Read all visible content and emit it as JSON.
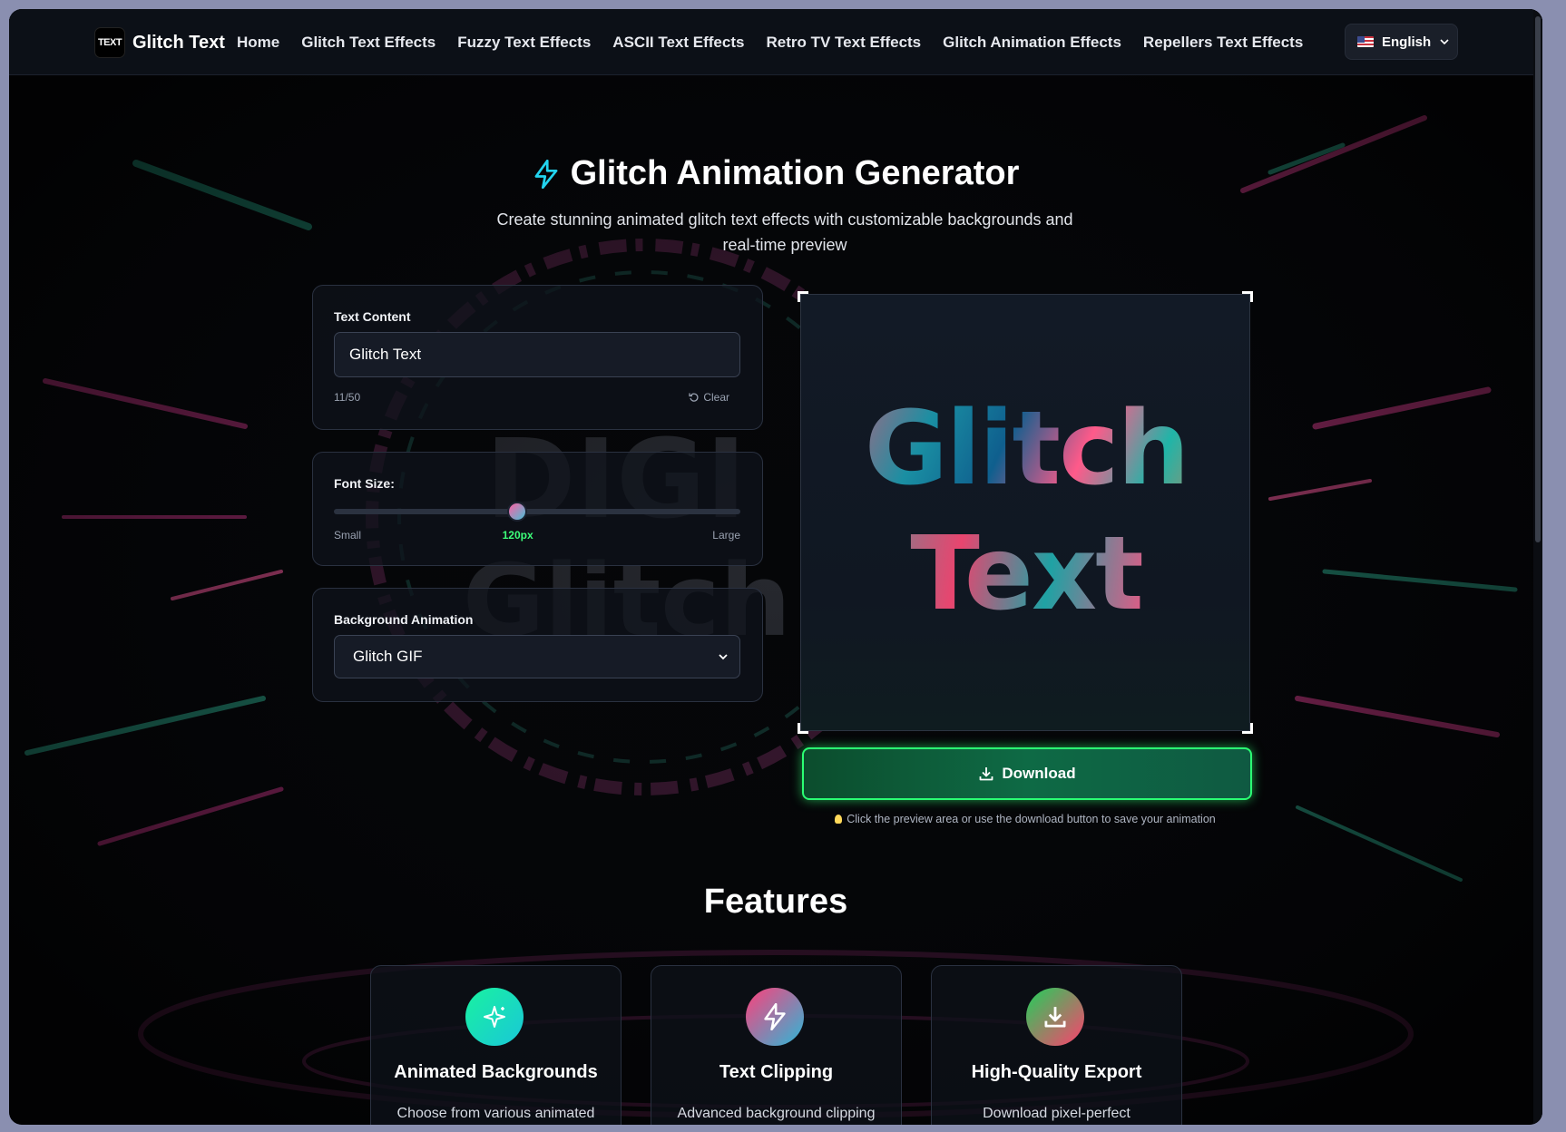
{
  "brand": {
    "logo_text": "TEXT",
    "name": "Glitch Text"
  },
  "nav": {
    "links": [
      "Home",
      "Glitch Text Effects",
      "Fuzzy Text Effects",
      "ASCII Text Effects",
      "Retro TV Text Effects",
      "Glitch Animation Effects",
      "Repellers Text Effects"
    ],
    "language": "English"
  },
  "hero": {
    "title": "Glitch Animation Generator",
    "subtitle": "Create stunning animated glitch text effects with customizable backgrounds and real-time preview"
  },
  "text_panel": {
    "label": "Text Content",
    "value": "Glitch Text",
    "counter": "11/50",
    "clear_label": "Clear"
  },
  "font_panel": {
    "label": "Font Size:",
    "min_label": "Small",
    "max_label": "Large",
    "value_label": "120px",
    "fraction": 0.45
  },
  "bg_panel": {
    "label": "Background Animation",
    "selected": "Glitch GIF"
  },
  "preview": {
    "line1": "Glitch",
    "line2": "Text"
  },
  "download": {
    "label": "Download",
    "hint": "Click the preview area or use the download button to save your animation"
  },
  "features": {
    "title": "Features",
    "cards": [
      {
        "title": "Animated Backgrounds",
        "desc": "Choose from various animated GIF and WebP"
      },
      {
        "title": "Text Clipping",
        "desc": "Advanced background clipping creates stunning"
      },
      {
        "title": "High-Quality Export",
        "desc": "Download pixel-perfect screenshots of your glitch"
      }
    ]
  },
  "colors": {
    "accent_green": "#2bff73",
    "accent_cyan": "#22d3ee",
    "accent_pink": "#ff4f8b"
  },
  "icons": [
    "bolt-icon",
    "refresh-icon",
    "download-icon",
    "sparkles-icon",
    "chevron-down-icon",
    "bulb-icon"
  ]
}
